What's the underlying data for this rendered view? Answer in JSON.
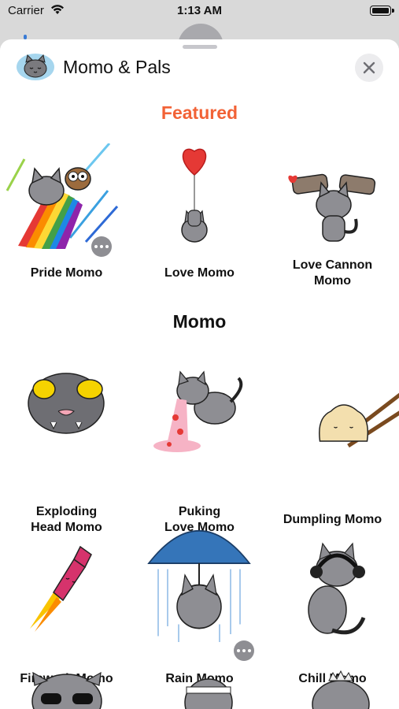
{
  "status_bar": {
    "carrier": "Carrier",
    "time": "1:13 AM"
  },
  "header": {
    "title": "Momo & Pals",
    "icon": "momo-cat-icon",
    "close_icon": "close-icon"
  },
  "sections": {
    "featured": {
      "title": "Featured",
      "stickers": [
        {
          "name": "Pride Momo",
          "icon": "rainbow-cat-sticker",
          "has_more": true
        },
        {
          "name": "Love Momo",
          "icon": "balloon-cat-sticker",
          "has_more": false
        },
        {
          "name": "Love Cannon\nMomo",
          "icon": "cannon-cat-sticker",
          "has_more": false
        }
      ]
    },
    "momo": {
      "title": "Momo",
      "stickers": [
        {
          "name": "Exploding\nHead Momo",
          "icon": "exploding-cat-sticker"
        },
        {
          "name": "Puking\nLove Momo",
          "icon": "puking-cat-sticker"
        },
        {
          "name": "Dumpling Momo",
          "icon": "dumpling-sticker"
        },
        {
          "name": "Firework Momo",
          "icon": "firework-sticker"
        },
        {
          "name": "Rain Momo",
          "icon": "rain-cat-sticker",
          "has_more": true
        },
        {
          "name": "Chill Momo",
          "icon": "headphones-cat-sticker"
        }
      ]
    }
  },
  "colors": {
    "featured": "#f26236",
    "cat_gray": "#8e8e93",
    "close_bg": "#ececee"
  }
}
